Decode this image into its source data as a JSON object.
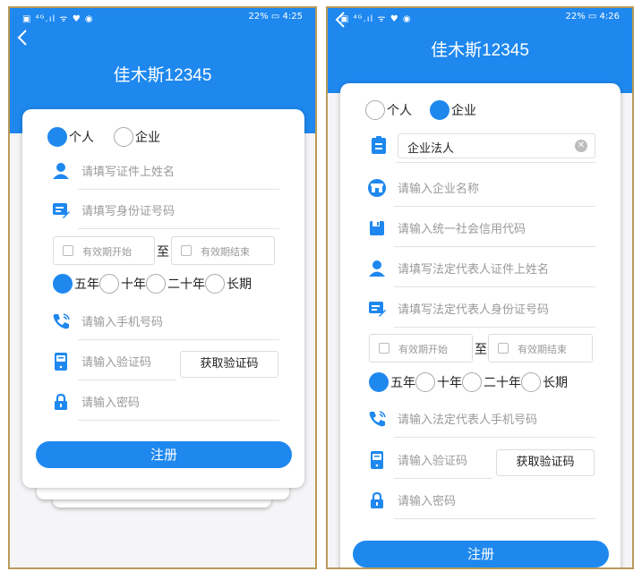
{
  "colors": {
    "primary": "#1e88ef",
    "frame_border": "#b99a5a",
    "hint_text": "#9a9a9a"
  },
  "screen1": {
    "status": {
      "left_icons": "▣ ⁴ᴳ.ıl ᯤ ♥ ◉",
      "battery": "22%",
      "time": "4:25"
    },
    "title": "佳木斯12345",
    "account_type": {
      "selected": "个人",
      "options": [
        "个人",
        "企业"
      ]
    },
    "fields": {
      "name": {
        "placeholder": "请填写证件上姓名",
        "icon": "person-icon"
      },
      "id_number": {
        "placeholder": "请填写身份证号码",
        "icon": "id-card-icon"
      },
      "phone": {
        "placeholder": "请输入手机号码",
        "icon": "phone-icon"
      },
      "code": {
        "placeholder": "请输入验证码",
        "icon": "sms-icon"
      },
      "password": {
        "placeholder": "请输入密码",
        "icon": "lock-icon"
      }
    },
    "validity": {
      "start": "有效期开始",
      "to": "至",
      "end": "有效期结束"
    },
    "duration": {
      "selected": "五年",
      "options": [
        "五年",
        "十年",
        "二十年",
        "长期"
      ]
    },
    "get_code": "获取验证码",
    "register": "注册"
  },
  "screen2": {
    "status": {
      "left_icons": "▣ ⁴ᴳ.ıl ᯤ ♥ ◉",
      "battery": "22%",
      "time": "4:26"
    },
    "title": "佳木斯12345",
    "account_type": {
      "selected": "企业",
      "options": [
        "个人",
        "企业"
      ]
    },
    "entity_type": {
      "value": "企业法人",
      "icon": "clipboard-icon"
    },
    "fields": {
      "company": {
        "placeholder": "请输入企业名称",
        "icon": "store-icon"
      },
      "credit_code": {
        "placeholder": "请输入统一社会信用代码",
        "icon": "save-icon"
      },
      "legal_name": {
        "placeholder": "请填写法定代表人证件上姓名",
        "icon": "person-icon"
      },
      "legal_id": {
        "placeholder": "请填写法定代表人身份证号码",
        "icon": "id-card-icon"
      },
      "legal_phone": {
        "placeholder": "请输入法定代表人手机号码",
        "icon": "phone-icon"
      },
      "code": {
        "placeholder": "请输入验证码",
        "icon": "sms-icon"
      },
      "password": {
        "placeholder": "请输入密码",
        "icon": "lock-icon"
      }
    },
    "validity": {
      "start": "有效期开始",
      "to": "至",
      "end": "有效期结束"
    },
    "duration": {
      "selected": "五年",
      "options": [
        "五年",
        "十年",
        "二十年",
        "长期"
      ]
    },
    "get_code": "获取验证码",
    "register": "注册"
  }
}
